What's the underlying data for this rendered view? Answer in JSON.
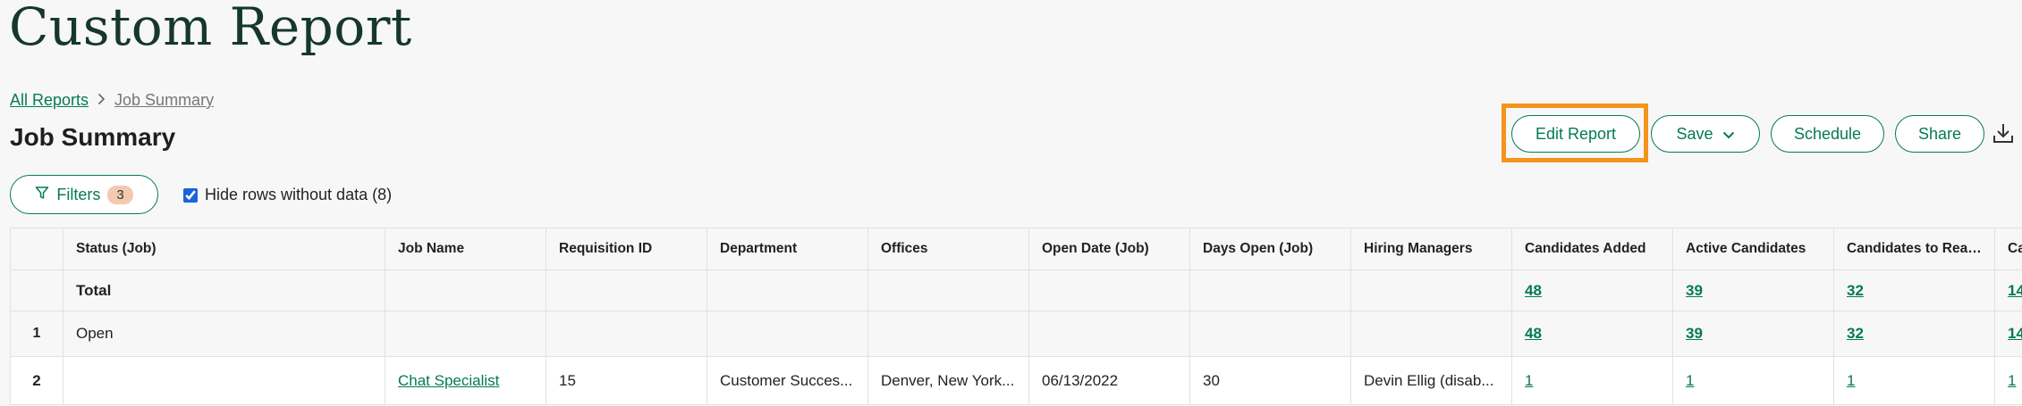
{
  "page": {
    "title": "Custom Report",
    "subtitle": "Job Summary"
  },
  "breadcrumb": {
    "root": "All Reports",
    "current": "Job Summary"
  },
  "toolbar": {
    "edit_report": "Edit Report",
    "save": "Save",
    "schedule": "Schedule",
    "share": "Share",
    "highlight_color": "#f4941b"
  },
  "filters": {
    "label": "Filters",
    "count": "3"
  },
  "hide_rows": {
    "label": "Hide rows without data (8)",
    "checked": true
  },
  "table": {
    "headers": [
      "",
      "Status (Job)",
      "Job Name",
      "Requisition ID",
      "Department",
      "Offices",
      "Open Date (Job)",
      "Days Open (Job)",
      "Hiring Managers",
      "Candidates Added",
      "Active Candidates",
      "Candidates to Reach As",
      "Ca"
    ],
    "total": {
      "label": "Total",
      "candidates_added": "48",
      "active_candidates": "39",
      "candidates_to_reach": "32",
      "last": "14"
    },
    "open_row": {
      "index": "1",
      "status": "Open",
      "candidates_added": "48",
      "active_candidates": "39",
      "candidates_to_reach": "32",
      "last": "14"
    },
    "data_row": {
      "index": "2",
      "status": "",
      "job_name": "Chat Specialist",
      "requisition_id": "15",
      "department": "Customer Succes...",
      "offices": "Denver, New York...",
      "open_date": "06/13/2022",
      "days_open": "30",
      "hiring_managers": "Devin Ellig (disab...",
      "candidates_added": "1",
      "active_candidates": "1",
      "candidates_to_reach": "1",
      "last": "1"
    }
  },
  "colors": {
    "brand_green": "#047a55",
    "title_green": "#15372c",
    "badge_bg": "#f4c9b0"
  }
}
